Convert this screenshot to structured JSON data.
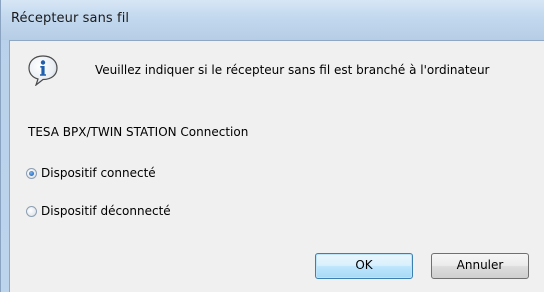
{
  "window": {
    "title": "Récepteur sans fil"
  },
  "message": {
    "icon": "info-icon",
    "text": "Veuillez indiquer si le récepteur sans fil est branché à l'ordinateur"
  },
  "connection": {
    "label": "TESA BPX/TWIN STATION Connection",
    "options": [
      {
        "label": "Dispositif connecté",
        "selected": true
      },
      {
        "label": "Dispositif déconnecté",
        "selected": false
      }
    ]
  },
  "buttons": {
    "ok": "OK",
    "cancel": "Annuler"
  },
  "colors": {
    "accent": "#3c7fb1",
    "titlebar": "#c2d8ee"
  }
}
